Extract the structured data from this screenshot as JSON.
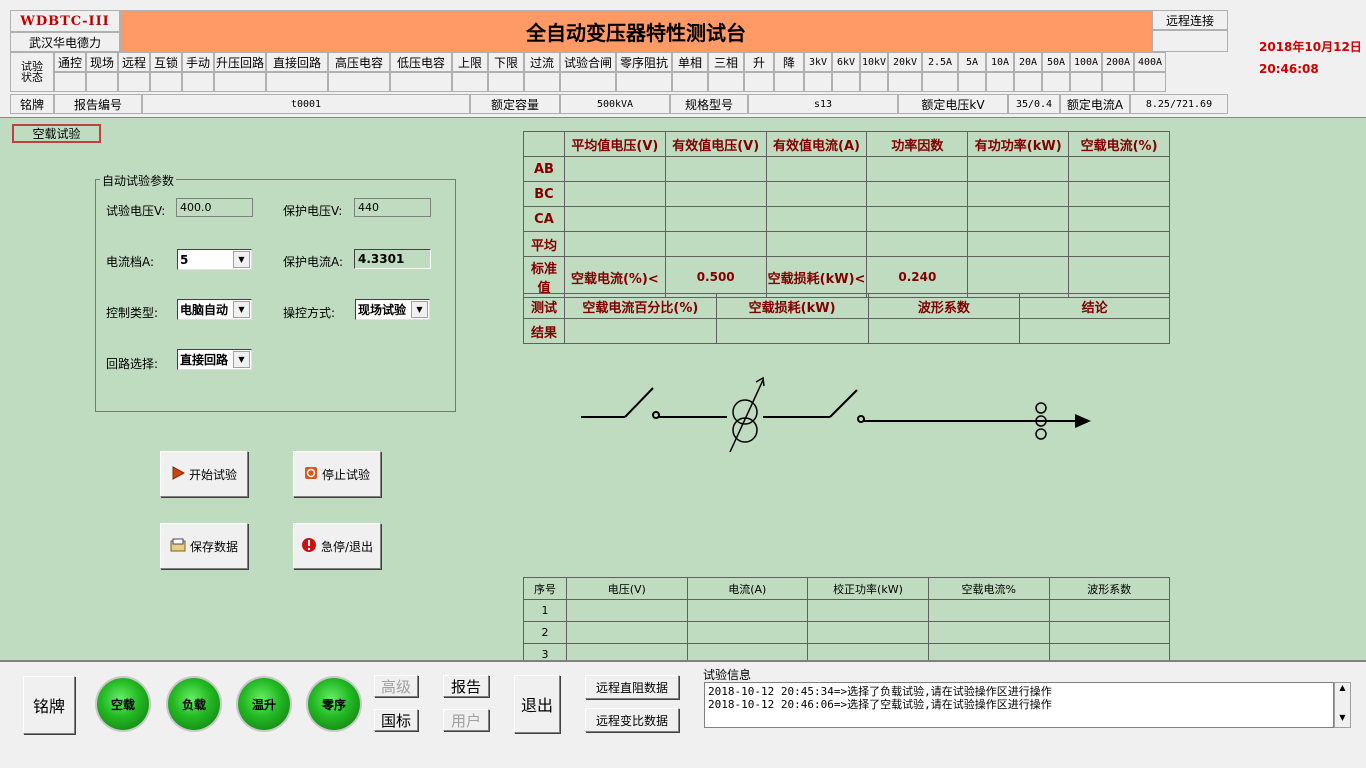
{
  "header": {
    "model": "WDBTC-III",
    "company": "武汉华电德力",
    "title": "全自动变压器特性测试台",
    "remote_connect": "远程连接",
    "date": "2018年10月12日",
    "time": "20:46:08"
  },
  "status_row": {
    "label": "试验状态",
    "items": [
      "通控",
      "现场",
      "远程",
      "互锁",
      "手动",
      "升压回路",
      "直接回路",
      "高压电容",
      "低压电容",
      "上限",
      "下限",
      "过流",
      "试验合闸",
      "零序阻抗",
      "单相",
      "三相",
      "升",
      "降",
      "3kV",
      "6kV",
      "10kV",
      "20kV",
      "2.5A",
      "5A",
      "10A",
      "20A",
      "50A",
      "100A",
      "200A",
      "400A"
    ]
  },
  "nameplate_row": {
    "label": "铭牌",
    "report_no_label": "报告编号",
    "report_no": "t0001",
    "capacity_label": "额定容量",
    "capacity": "500kVA",
    "spec_label": "规格型号",
    "spec": "s13",
    "voltage_label": "额定电压kV",
    "voltage": "35/0.4",
    "current_label": "额定电流A",
    "current": "8.25/721.69"
  },
  "test_tab": "空载试验",
  "params": {
    "title": "自动试验参数",
    "test_voltage_label": "试验电压V:",
    "test_voltage": "400.0",
    "protect_voltage_label": "保护电压V:",
    "protect_voltage": "440",
    "current_range_label": "电流档A:",
    "current_range": "5",
    "protect_current_label": "保护电流A:",
    "protect_current": "4.3301",
    "control_type_label": "控制类型:",
    "control_type": "电脑自动",
    "operate_mode_label": "操控方式:",
    "operate_mode": "现场试验",
    "circuit_label": "回路选择:",
    "circuit": "直接回路"
  },
  "actions": {
    "start": "开始试验",
    "stop": "停止试验",
    "save": "保存数据",
    "emergency": "急停/退出"
  },
  "result_table": {
    "headers": [
      "平均值电压(V)",
      "有效值电压(V)",
      "有效值电流(A)",
      "功率因数",
      "有功功率(kW)",
      "空载电流(%)"
    ],
    "rows": [
      "AB",
      "BC",
      "CA",
      "平均"
    ],
    "std_label": "标准值",
    "std_current_label": "空载电流(%)<",
    "std_current": "0.500",
    "std_loss_label": "空载损耗(kW)<",
    "std_loss": "0.240",
    "test_label": "测试",
    "result_label": "结果",
    "result_headers": [
      "空载电流百分比(%)",
      "空载损耗(kW)",
      "波形系数",
      "结论"
    ]
  },
  "seq_table": {
    "headers": [
      "序号",
      "电压(V)",
      "电流(A)",
      "校正功率(kW)",
      "空载电流%",
      "波形系数"
    ],
    "rows": [
      "1",
      "2",
      "3"
    ]
  },
  "bottom": {
    "nameplate": "铭牌",
    "noload": "空载",
    "load": "负载",
    "temp_rise": "温升",
    "zero_seq": "零序",
    "advanced": "高级",
    "report": "报告",
    "national_std": "国标",
    "user": "用户",
    "exit": "退出",
    "remote_dc": "远程直阻数据",
    "remote_ratio": "远程变比数据",
    "log_title": "试验信息",
    "log": [
      "2018-10-12 20:45:34=>选择了负载试验,请在试验操作区进行操作",
      "2018-10-12 20:46:06=>选择了空载试验,请在试验操作区进行操作"
    ]
  }
}
